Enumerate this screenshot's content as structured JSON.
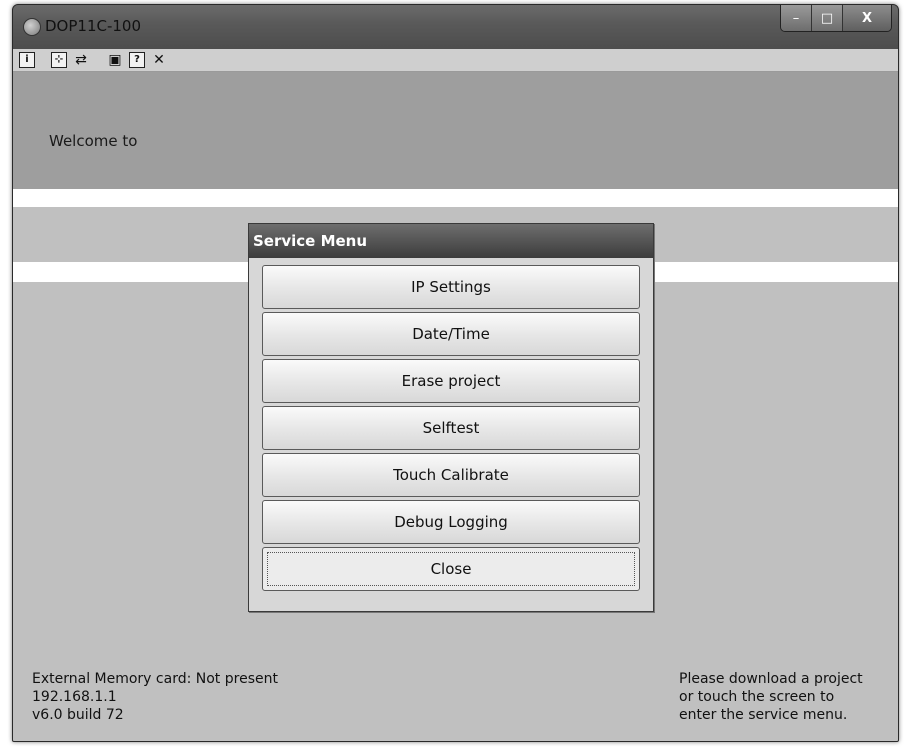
{
  "window": {
    "title": "DOP11C-100",
    "controls": {
      "minimize": "–",
      "maximize": "□",
      "close": "X"
    }
  },
  "toolbar": {
    "icons": [
      "info-icon",
      "fullscreen-icon",
      "refresh-icon",
      "save-icon",
      "help-icon",
      "tools-icon"
    ],
    "info_glyph": "i",
    "fullscreen_glyph": "⊹",
    "refresh_glyph": "⇄",
    "save_glyph": "▣",
    "help_glyph": "?",
    "tools_glyph": "✕"
  },
  "banner": {
    "welcome": "Welcome to"
  },
  "service_menu": {
    "title": "Service Menu",
    "buttons": [
      "IP Settings",
      "Date/Time",
      "Erase project",
      "Selftest",
      "Touch Calibrate",
      "Debug Logging",
      "Close"
    ]
  },
  "status": {
    "memory": "External Memory card: Not present",
    "ip": "192.168.1.1",
    "version": "v6.0 build 72",
    "hint_line1": "Please download a project",
    "hint_line2": "or touch the screen to",
    "hint_line3": "enter the service menu."
  },
  "colors": {
    "titlebar": "#5a5a5a",
    "banner": "#9e9e9e",
    "client": "#c0c0c0",
    "dialog_title": "#3c3c3c"
  }
}
